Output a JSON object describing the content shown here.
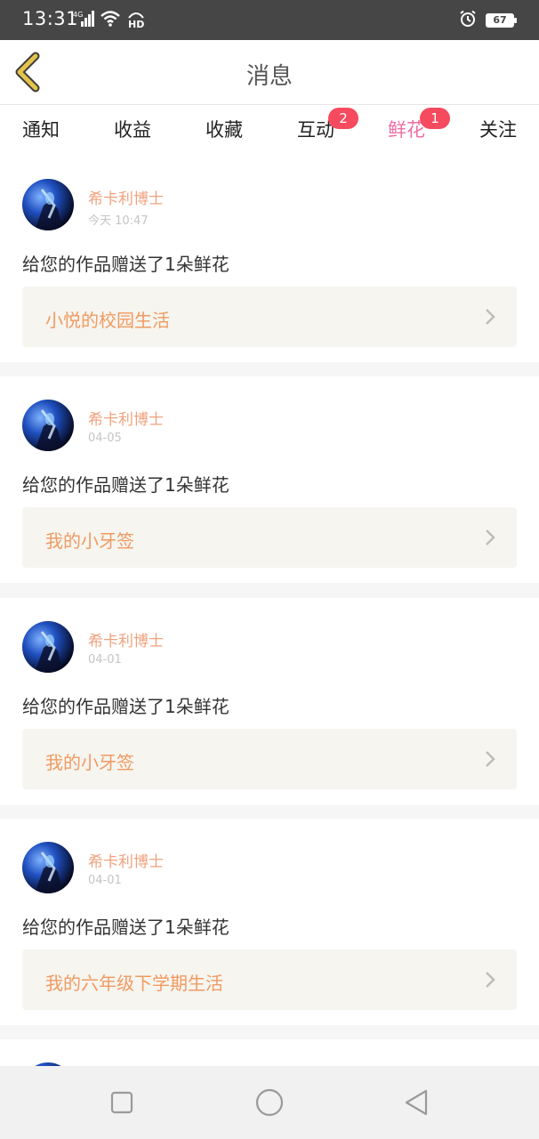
{
  "status_bar": {
    "time": "13:31",
    "network": "4G",
    "hd": "HD",
    "battery": "67",
    "icons": [
      "signal-icon",
      "wifi-icon",
      "hd-icon",
      "alarm-icon",
      "battery-icon"
    ]
  },
  "header": {
    "title": "消息",
    "back_icon": "chevron-left-icon"
  },
  "tabs": [
    {
      "label": "通知",
      "badge": null,
      "active": false
    },
    {
      "label": "收益",
      "badge": null,
      "active": false
    },
    {
      "label": "收藏",
      "badge": null,
      "active": false
    },
    {
      "label": "互动",
      "badge": "2",
      "active": false
    },
    {
      "label": "鲜花",
      "badge": "1",
      "active": true
    },
    {
      "label": "关注",
      "badge": null,
      "active": false
    }
  ],
  "notifications": [
    {
      "user": "希卡利博士",
      "time": "今天 10:47",
      "message": "给您的作品赠送了1朵鲜花",
      "work_title": "小悦的校园生活"
    },
    {
      "user": "希卡利博士",
      "time": "04-05",
      "message": "给您的作品赠送了1朵鲜花",
      "work_title": "我的小牙签"
    },
    {
      "user": "希卡利博士",
      "time": "04-01",
      "message": "给您的作品赠送了1朵鲜花",
      "work_title": "我的小牙签"
    },
    {
      "user": "希卡利博士",
      "time": "04-01",
      "message": "给您的作品赠送了1朵鲜花",
      "work_title": "我的六年级下学期生活"
    }
  ],
  "colors": {
    "accent_pink": "#ee6fa6",
    "username_orange": "#f0a27e",
    "work_title_orange": "#f09a62",
    "badge_red": "#f64a5e",
    "back_arrow": "#e3c34a"
  },
  "system_nav": {
    "icons": [
      "recent-apps-icon",
      "home-icon",
      "back-icon"
    ]
  }
}
